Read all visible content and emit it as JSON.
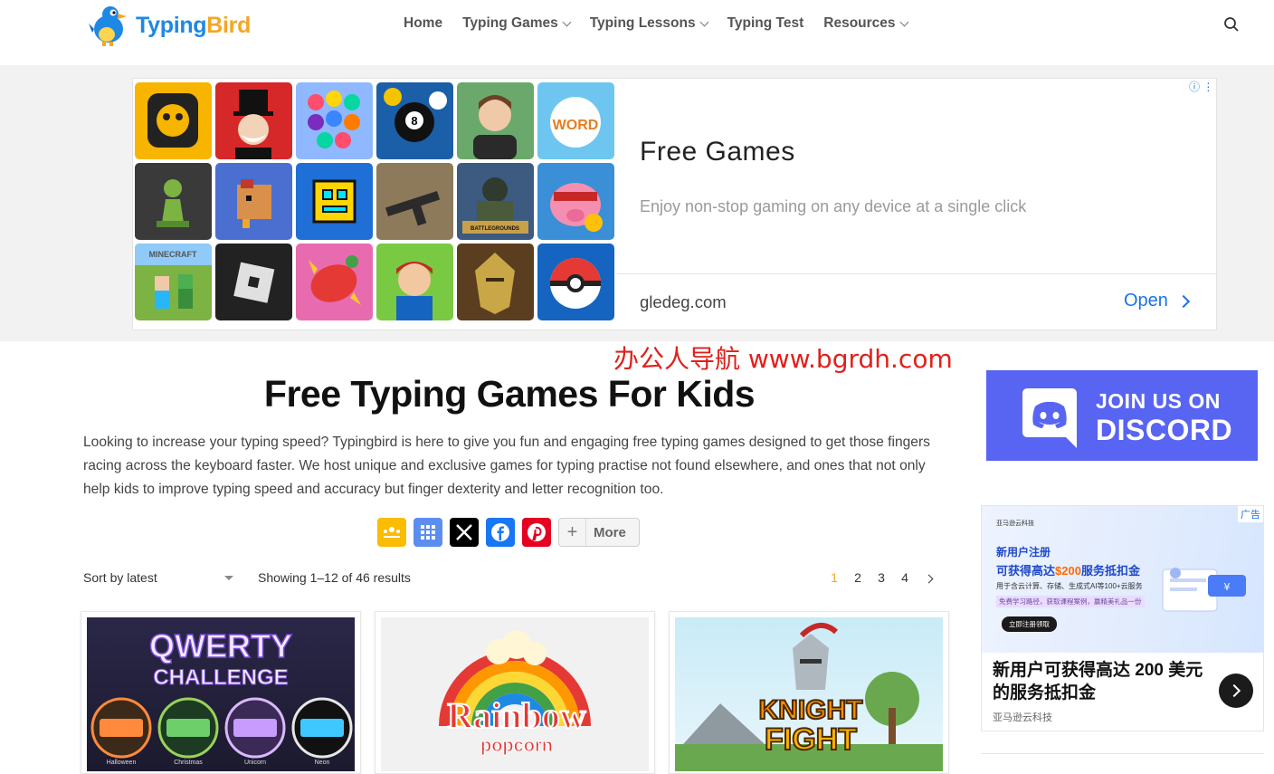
{
  "header": {
    "logo": {
      "part1": "Typing",
      "part2": "Bird"
    },
    "nav": [
      {
        "label": "Home",
        "dropdown": false
      },
      {
        "label": "Typing Games",
        "dropdown": true
      },
      {
        "label": "Typing Lessons",
        "dropdown": true
      },
      {
        "label": "Typing Test",
        "dropdown": false
      },
      {
        "label": "Resources",
        "dropdown": true
      }
    ],
    "search_icon": "search-icon"
  },
  "top_ad": {
    "title": "Free Games",
    "description": "Enjoy non-stop gaming on any device at a single click",
    "domain": "gledeg.com",
    "open_label": "Open",
    "info_icon": "ⓘ ⋮",
    "tile_logo_texts": {
      "minecraft": "MINECRAFT",
      "battlegrounds": "BATTLEGROUNDS",
      "word": "WORD"
    },
    "tiles": [
      "brawl-stars",
      "monopoly",
      "color-sort",
      "8-ball-pool",
      "avatar-boy",
      "word-game",
      "chess",
      "stardew-chicken",
      "geometry-dash",
      "shooter",
      "pubg",
      "coin-master",
      "minecraft",
      "roblox",
      "candy-crush",
      "subway-surfers",
      "knight-helmet",
      "pokeball"
    ]
  },
  "watermark": "办公人导航  www.bgrdh.com",
  "main": {
    "title": "Free Typing Games For Kids",
    "intro": "Looking to increase your typing speed? Typingbird is here to give you fun and engaging free typing games designed to get those fingers racing across the keyboard faster. We host unique and exclusive games for typing practise not found elsewhere, and ones that not only help kids to improve typing speed and accuracy but finger dexterity and letter recognition too.",
    "share": {
      "buttons": [
        {
          "name": "google-classroom-icon",
          "color": "#fbbc04"
        },
        {
          "name": "apps-grid-icon",
          "color": "#5b8ef0"
        },
        {
          "name": "x-icon",
          "color": "#000000"
        },
        {
          "name": "facebook-icon",
          "color": "#1877f2"
        },
        {
          "name": "pinterest-icon",
          "color": "#e60023"
        }
      ],
      "more_label": "More"
    },
    "sort_label": "Sort by latest",
    "results_text": "Showing 1–12 of 46 results",
    "pagination": {
      "pages": [
        "1",
        "2",
        "3",
        "4"
      ],
      "current": "1"
    },
    "cards": [
      {
        "title_line1": "QWERTY",
        "title_line2": "CHALLENGE",
        "keyboards": [
          "Halloween",
          "Christmas",
          "Unicorn",
          "Neon"
        ]
      },
      {
        "title_line1": "Rainbow",
        "title_line2": "popcorn"
      },
      {
        "title_line1": "KNIGHT",
        "title_line2": "FIGHT"
      }
    ]
  },
  "sidebar": {
    "discord": {
      "line1": "JOIN US ON",
      "line2": "DISCORD"
    },
    "ad": {
      "brand": "亚马逊云科技",
      "line1": "新用户注册",
      "line2_prefix": "可获得高达",
      "line2_amount": "$200",
      "line2_suffix": "服务抵扣金",
      "line3": "用于含云计算、存储、生成式AI等100+云服务",
      "line4": "免费学习路径，获取课程案例，赢精美礼品一份",
      "cta": "立即注册领取",
      "badge": "广告",
      "headline": "新用户可获得高达 200 美元的服务抵扣金",
      "advertiser": "亚马逊云科技"
    }
  },
  "colors": {
    "brand_blue": "#1e88e5",
    "brand_orange": "#f5a623",
    "discord": "#5865f2",
    "ad_link": "#1a73e8"
  }
}
